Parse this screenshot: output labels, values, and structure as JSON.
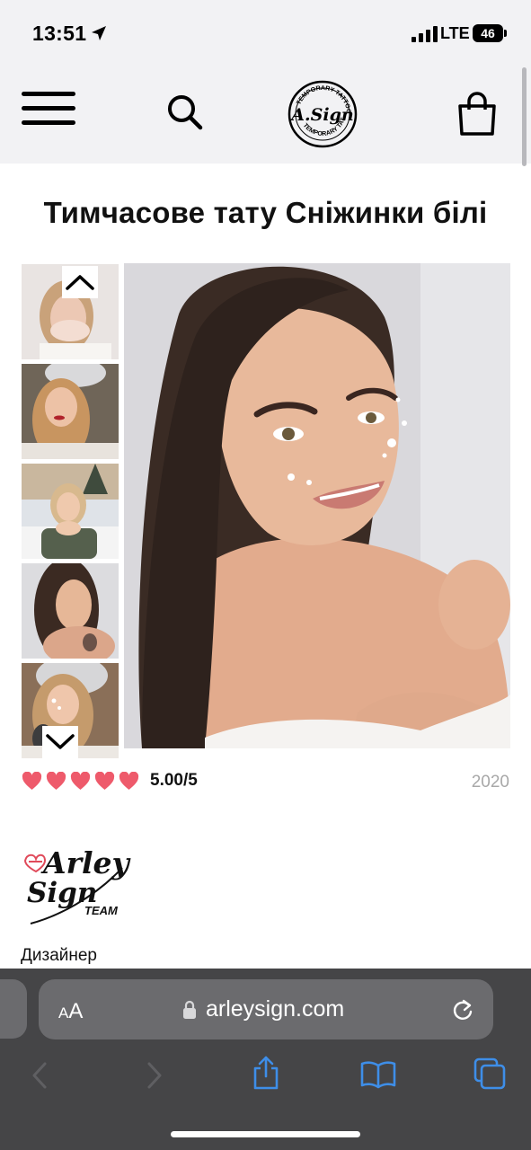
{
  "status_bar": {
    "time": "13:51",
    "network": "LTE",
    "battery": "46"
  },
  "header": {
    "logo_text": "A.Sign",
    "logo_ring_text": "TEMPORARY TATTOO"
  },
  "product": {
    "title": "Тимчасове тату Сніжинки білі",
    "rating_hearts": 5,
    "rating_value": "5.00/5",
    "year": "2020",
    "designer_label": "Дизайнер",
    "designer_logo_text": "Arley Sign TEAM"
  },
  "browser": {
    "text_size_label_small": "A",
    "text_size_label_large": "A",
    "url": "arleysign.com"
  },
  "colors": {
    "heart": "#ee5a6b",
    "header_bg": "#f2f2f4",
    "safari_bar": "#454547",
    "ios_blue": "#3e8ee8"
  }
}
